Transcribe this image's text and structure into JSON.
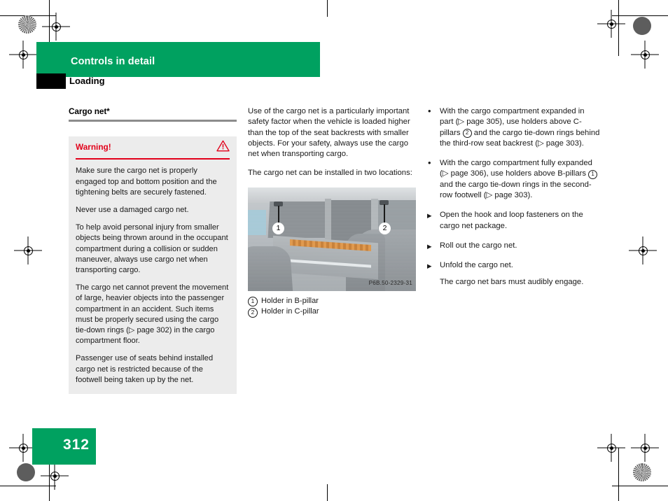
{
  "header": {
    "chapter": "Controls in detail",
    "section": "Loading"
  },
  "page_number": "312",
  "colors": {
    "brand_green": "#00a160",
    "warning_red": "#e2001a",
    "rule_gray": "#8c8c8c",
    "warn_bg": "#ececec"
  },
  "column_left": {
    "subhead": "Cargo net*",
    "warning": {
      "label": "Warning!",
      "icon": "warning-triangle-icon",
      "paragraphs": [
        "Make sure the cargo net is properly engaged top and bottom position and the tightening belts are securely fastened.",
        "Never use a damaged cargo net.",
        "To help avoid personal injury from smaller objects being thrown around in the occupant compartment during a collision or sudden maneuver, always use cargo net when transporting cargo.",
        "The cargo net cannot prevent the movement of large, heavier objects into the passenger compartment in an accident. Such items must be properly secured using the cargo tie-down rings (▷ page 302) in the cargo compartment floor.",
        "Passenger use of seats behind installed cargo net is restricted because of the footwell being taken up by the net."
      ]
    }
  },
  "column_middle": {
    "paragraphs": [
      "Use of the cargo net is a particularly important safety factor when the vehicle is loaded higher than the top of the seat backrests with smaller objects. For your safety, always use the cargo net when transporting cargo.",
      "The cargo net can be installed in two locations:"
    ],
    "figure": {
      "image_code": "P6B.50-2329-31",
      "callouts": [
        {
          "number": "1"
        },
        {
          "number": "2"
        }
      ],
      "legend": [
        {
          "number": "1",
          "text": "Holder in B-pillar"
        },
        {
          "number": "2",
          "text": "Holder in C-pillar"
        }
      ]
    }
  },
  "column_right": {
    "bullets": [
      {
        "part1": "With the cargo compartment expanded in part (▷ page 305), use holders above C-pillars ",
        "circled": "2",
        "part2": " and the cargo tie-down rings behind the third-row seat backrest (▷ page 303)."
      },
      {
        "part1": "With the cargo compartment fully expanded (▷ page 306), use holders above B-pillars ",
        "circled": "1",
        "part2": " and the cargo tie-down rings in the second-row footwell (▷ page 303)."
      }
    ],
    "steps": [
      {
        "text": "Open the hook and loop fasteners on the cargo net package.",
        "marker": "arrow"
      },
      {
        "text": "Roll out the cargo net.",
        "marker": "arrow"
      },
      {
        "text": "Unfold the cargo net.",
        "marker": "arrow"
      },
      {
        "text": "The cargo net bars must audibly engage.",
        "marker": "none"
      }
    ]
  }
}
